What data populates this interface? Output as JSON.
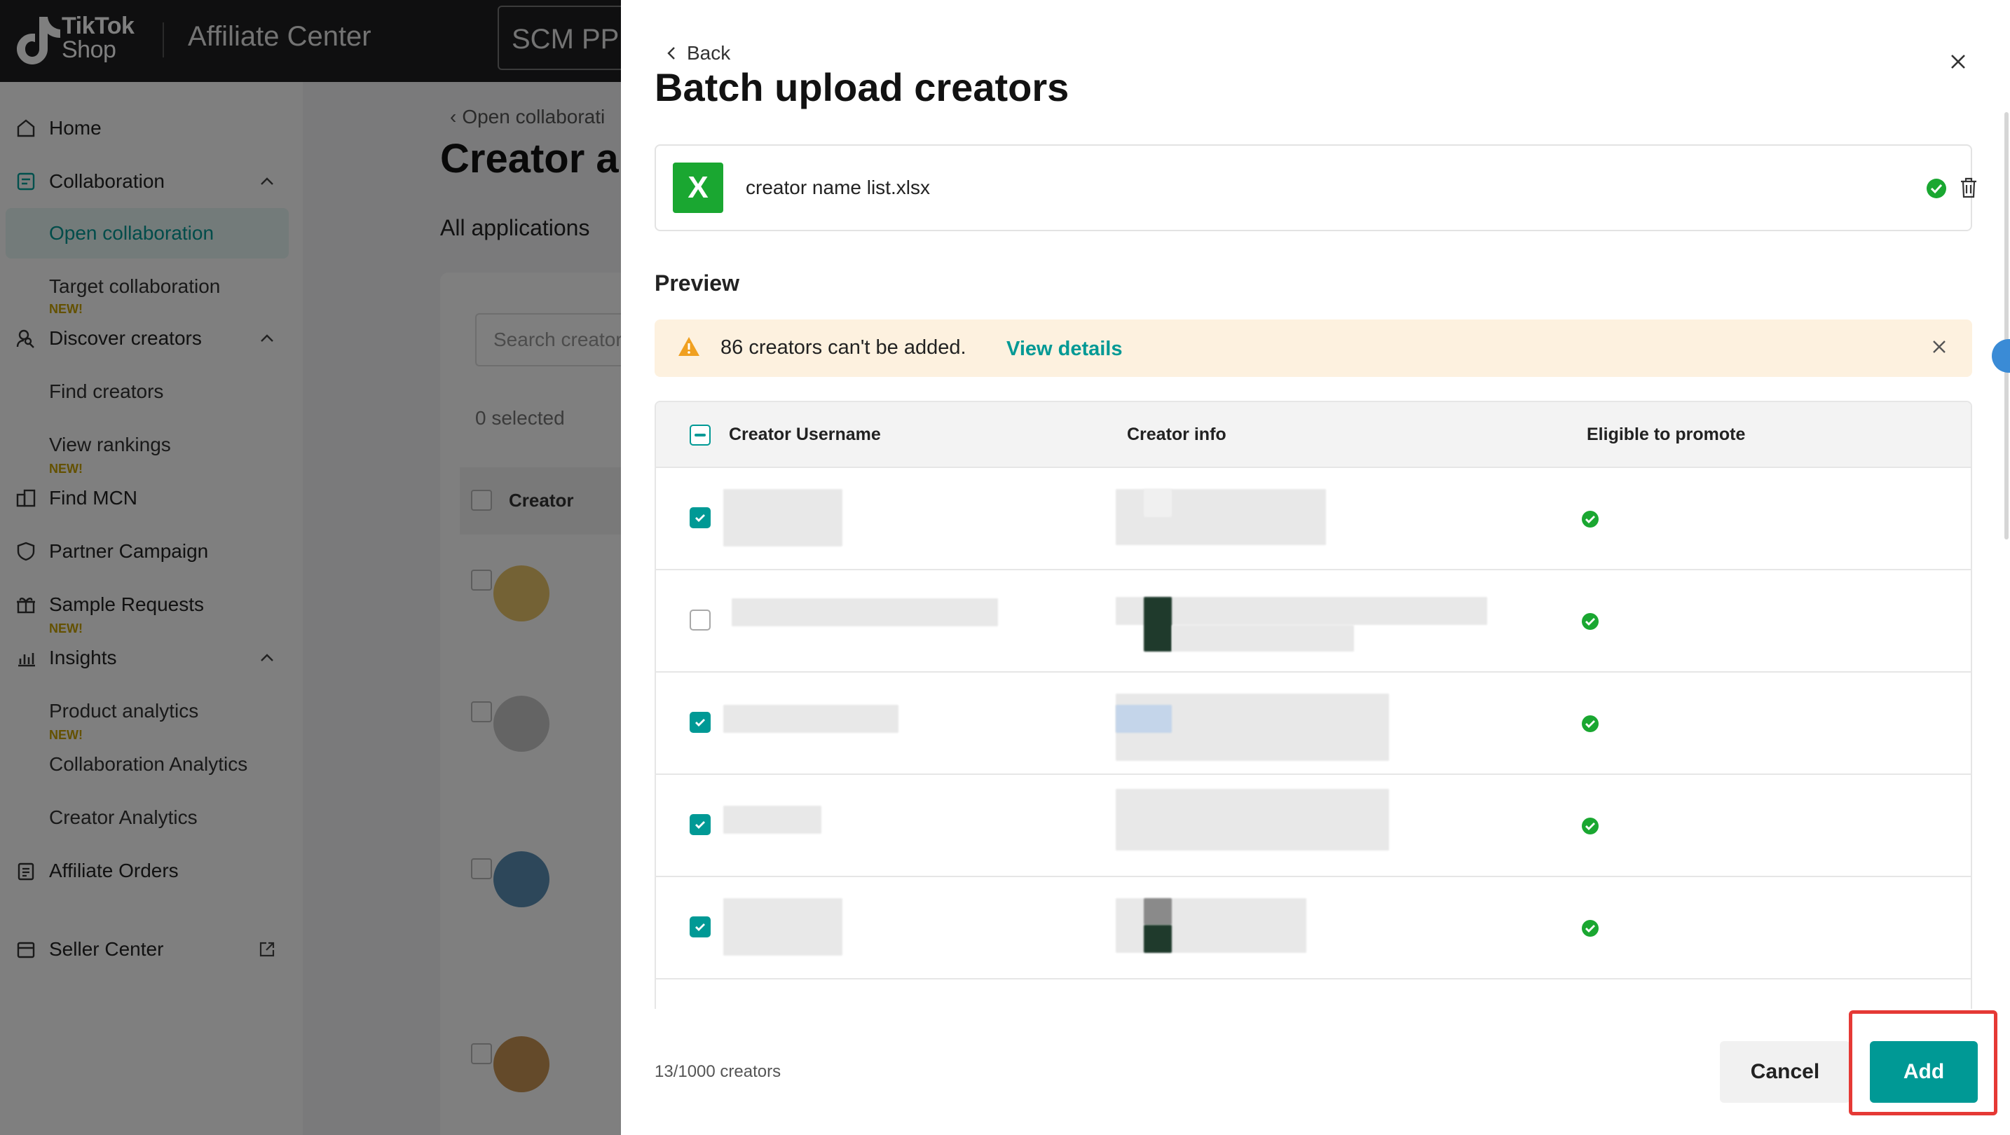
{
  "app": {
    "logo_line1": "TikTok",
    "logo_line2": "Shop",
    "name": "Affiliate Center",
    "shop_name": "SCM PPI"
  },
  "sidebar": {
    "items": [
      {
        "label": "Home",
        "icon": "home-icon"
      },
      {
        "label": "Collaboration",
        "icon": "collaboration-icon"
      },
      {
        "label": "Open collaboration"
      },
      {
        "label": "Target collaboration",
        "tag": "NEW!"
      },
      {
        "label": "Discover creators",
        "icon": "discover-icon"
      },
      {
        "label": "Find creators"
      },
      {
        "label": "View rankings",
        "tag": "NEW!"
      },
      {
        "label": "Find MCN",
        "icon": "mcn-icon"
      },
      {
        "label": "Partner Campaign",
        "icon": "shield-icon"
      },
      {
        "label": "Sample Requests",
        "icon": "gift-icon",
        "tag": "NEW!"
      },
      {
        "label": "Insights",
        "icon": "chart-icon"
      },
      {
        "label": "Product analytics",
        "tag": "NEW!"
      },
      {
        "label": "Collaboration Analytics"
      },
      {
        "label": "Creator Analytics"
      },
      {
        "label": "Affiliate Orders",
        "icon": "clipboard-icon"
      },
      {
        "label": "Seller Center",
        "icon": "store-icon"
      }
    ]
  },
  "page": {
    "breadcrumb": "Open collaborati",
    "title": "Creator ap",
    "tab": "All applications",
    "search_placeholder": "Search creators",
    "selected": "0 selected",
    "creator_col": "Creator"
  },
  "drawer": {
    "back_label": "Back",
    "title": "Batch upload creators",
    "file_name": "creator name list.xlsx",
    "file_icon_letter": "X",
    "preview_label": "Preview",
    "alert_text": "86 creators can't be added.",
    "alert_link": "View details",
    "columns": {
      "username": "Creator Username",
      "info": "Creator info",
      "eligible": "Eligible to promote"
    },
    "rows": [
      {
        "checked": true,
        "eligible": true
      },
      {
        "checked": false,
        "eligible": true
      },
      {
        "checked": true,
        "eligible": true
      },
      {
        "checked": true,
        "eligible": true
      },
      {
        "checked": true,
        "eligible": true
      }
    ],
    "footer_count": "13/1000 creators",
    "cancel_label": "Cancel",
    "add_label": "Add"
  },
  "colors": {
    "accent": "#009995",
    "success": "#1aa731",
    "warning_bg": "#fdf1df",
    "warning_icon": "#f0a020",
    "highlight": "#e53935"
  }
}
